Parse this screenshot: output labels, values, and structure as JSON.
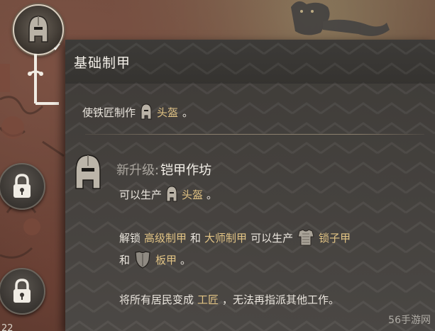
{
  "tooltip": {
    "title": "基础制甲",
    "line1": {
      "prefix": "使铁匠制作",
      "item": "头盔",
      "suffix": "。"
    },
    "upgrade": {
      "prefix": "新升级:",
      "name": "铠甲作坊"
    },
    "produce": {
      "prefix": "可以生产",
      "item": "头盔",
      "suffix": "。"
    },
    "unlock": {
      "w1": "解锁",
      "link1": "高级制甲",
      "w2": "和",
      "link2": "大师制甲",
      "w3": "可以生产",
      "item1": "锁子甲",
      "w4": "和",
      "item2": "板甲",
      "suffix": "。"
    },
    "convert": {
      "prefix": "将所有居民变成",
      "link": "工匠",
      "suffix": "，无法再指派其他工作。"
    }
  },
  "watermark": "56手游网",
  "corner_number": "22",
  "colors": {
    "highlight": "#e2c485",
    "panel": "#3d3b38",
    "text": "#e9e4dc"
  },
  "icons": {
    "skill": "helmet-icon",
    "locks": [
      "lock-icon",
      "lock-icon"
    ],
    "chainmail": "chainmail-icon",
    "plate": "plate-armor-icon"
  }
}
